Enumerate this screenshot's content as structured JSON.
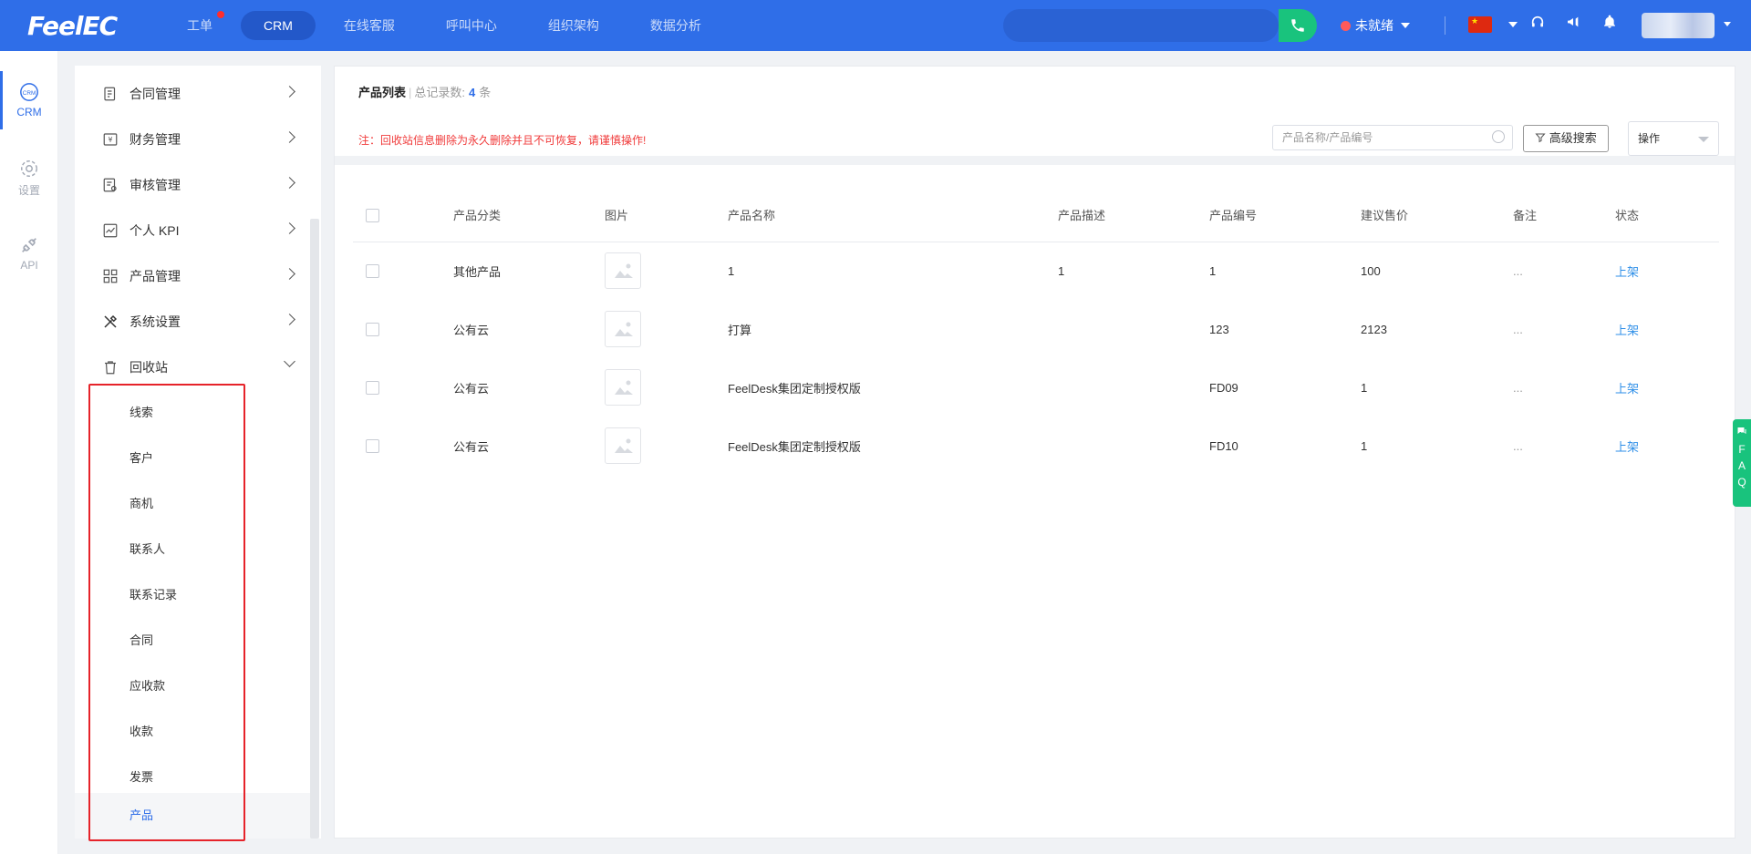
{
  "app": {
    "logo": "FeelEC"
  },
  "nav": [
    {
      "label": "工单",
      "badge": true
    },
    {
      "label": "CRM",
      "active": true
    },
    {
      "label": "在线客服"
    },
    {
      "label": "呼叫中心"
    },
    {
      "label": "组织架构"
    },
    {
      "label": "数据分析"
    }
  ],
  "header": {
    "status_label": "未就绪",
    "status_color": "#ff5a5a"
  },
  "rail": [
    {
      "label": "CRM",
      "icon": "crm-icon",
      "active": true
    },
    {
      "label": "设置",
      "icon": "settings-icon"
    },
    {
      "label": "API",
      "icon": "api-plug-icon"
    }
  ],
  "menu": [
    {
      "label": "合同管理",
      "icon": "contract-icon"
    },
    {
      "label": "财务管理",
      "icon": "finance-icon"
    },
    {
      "label": "审核管理",
      "icon": "audit-icon"
    },
    {
      "label": "个人 KPI",
      "icon": "kpi-chart-icon"
    },
    {
      "label": "产品管理",
      "icon": "product-grid-icon"
    },
    {
      "label": "系统设置",
      "icon": "tools-icon"
    },
    {
      "label": "回收站",
      "icon": "recycle-bin-icon",
      "expanded": true
    }
  ],
  "recycle_sub": [
    "线索",
    "客户",
    "商机",
    "联系人",
    "联系记录",
    "合同",
    "应收款",
    "收款",
    "发票",
    "产品"
  ],
  "main": {
    "title": "产品列表",
    "total_label": "总记录数:",
    "total_count": "4",
    "total_unit": "条",
    "notice": "注：回收站信息删除为永久删除并且不可恢复，请谨慎操作!",
    "search_placeholder": "产品名称/产品编号",
    "advanced_search": "高级搜索",
    "operation": "操作"
  },
  "table": {
    "columns": [
      "产品分类",
      "图片",
      "产品名称",
      "产品描述",
      "产品编号",
      "建议售价",
      "备注",
      "状态"
    ],
    "rows": [
      {
        "category": "其他产品",
        "name": "1",
        "desc": "1",
        "code": "1",
        "price": "100",
        "remark": "...",
        "status": "上架"
      },
      {
        "category": "公有云",
        "name": "打算",
        "desc": "",
        "code": "123",
        "price": "2123",
        "remark": "...",
        "status": "上架"
      },
      {
        "category": "公有云",
        "name": "FeelDesk集团定制授权版",
        "desc": "",
        "code": "FD09",
        "price": "1",
        "remark": "...",
        "status": "上架"
      },
      {
        "category": "公有云",
        "name": "FeelDesk集团定制授权版",
        "desc": "",
        "code": "FD10",
        "price": "1",
        "remark": "...",
        "status": "上架"
      }
    ]
  },
  "faq": [
    "F",
    "A",
    "Q"
  ],
  "colors": {
    "primary": "#2f6ee8",
    "danger": "#e6232a",
    "success": "#19c37d"
  }
}
